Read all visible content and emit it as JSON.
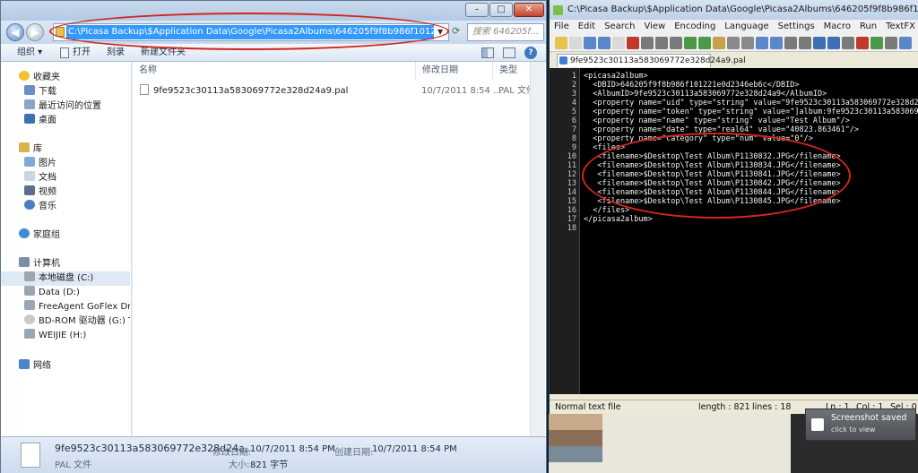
{
  "explorer": {
    "address": "C:\\Picasa Backup\\$Application Data\\Google\\Picasa2Albums\\646205f9f8b986f101221e0d2346eb6c",
    "search_placeholder": "搜索 646205f...",
    "toolbar": {
      "organize": "组织 ▾",
      "open": "打开",
      "burn": "刻录",
      "new_folder": "新建文件夹"
    },
    "caption": {
      "min": "–",
      "max": "□",
      "close": "✕"
    },
    "nav": {
      "favorites": "收藏夹",
      "downloads": "下载",
      "recent": "最近访问的位置",
      "desktop": "桌面",
      "libraries": "库",
      "pictures": "图片",
      "documents": "文档",
      "videos": "视频",
      "music": "音乐",
      "homegroup": "家庭组",
      "computer": "计算机",
      "drive_c": "本地磁盘 (C:)",
      "drive_d": "Data (D:)",
      "drive_freeagent": "FreeAgent GoFlex Drive (",
      "drive_bd": "BD-ROM 驱动器 (G:) TON",
      "drive_h": "WEIJIE (H:)",
      "network": "网络"
    },
    "columns": {
      "name": "名称",
      "modified": "修改日期",
      "type": "类型"
    },
    "file": {
      "name": "9fe9523c30113a583069772e328d24a9.pal",
      "modified": "10/7/2011 8:54 ...",
      "type": "PAL 文件"
    },
    "details": {
      "name": "9fe9523c30113a583069772e328d24a...",
      "type": "PAL 文件",
      "modified_label": "修改日期:",
      "modified_value": "10/7/2011 8:54 PM",
      "created_label": "创建日期:",
      "created_value": "10/7/2011 8:54 PM",
      "size_label": "大小:",
      "size_value": "821 字节"
    }
  },
  "npp": {
    "title": "C:\\Picasa Backup\\$Application Data\\Google\\Picasa2Albums\\646205f9f8b986f101221e0d2346eb",
    "menu": [
      "File",
      "Edit",
      "Search",
      "View",
      "Encoding",
      "Language",
      "Settings",
      "Macro",
      "Run",
      "TextFX",
      "Plugins",
      "Wi"
    ],
    "tab": "9fe9523c30113a583069772e328d24a9.pal",
    "line_numbers": [
      "1",
      "2",
      "3",
      "4",
      "5",
      "6",
      "7",
      "8",
      "9",
      "10",
      "11",
      "12",
      "13",
      "14",
      "15",
      "16",
      "17",
      "18"
    ],
    "lines": [
      "<picasa2album>",
      "  <DBID>646205f9f8b986f101221e0d2346eb6c</DBID>",
      "  <AlbumID>9fe9523c30113a583069772e328d24a9</AlbumID>",
      "  <property name=\"uid\" type=\"string\" value=\"9fe9523c30113a583069772e328d24a9",
      "  <property name=\"token\" type=\"string\" value=\"]album:9fe9523c30113a583069772e",
      "  <property name=\"name\" type=\"string\" value=\"Test Album\"/>",
      "  <property name=\"date\" type=\"real64\" value=\"40823.863461\"/>",
      "  <property name=\"category\" type=\"num\" value=\"0\"/>",
      "  <files>",
      "   <filename>$Desktop\\Test Album\\P1130832.JPG</filename>",
      "   <filename>$Desktop\\Test Album\\P1130834.JPG</filename>",
      "   <filename>$Desktop\\Test Album\\P1130841.JPG</filename>",
      "   <filename>$Desktop\\Test Album\\P1130842.JPG</filename>",
      "   <filename>$Desktop\\Test Album\\P1130844.JPG</filename>",
      "   <filename>$Desktop\\Test Album\\P1130845.JPG</filename>",
      "  </files>",
      "</picasa2album>",
      ""
    ],
    "status": {
      "type": "Normal text file",
      "length": "length : 821",
      "lines": "lines : 18",
      "ln": "Ln : 1",
      "col": "Col : 1",
      "sel": "Sel : 0"
    }
  },
  "toast": {
    "title": "Screenshot saved",
    "sub": "click to view"
  },
  "colors": {
    "annotation": "#d0261f",
    "selection": "#3399ff",
    "editor_bg": "#000000"
  }
}
